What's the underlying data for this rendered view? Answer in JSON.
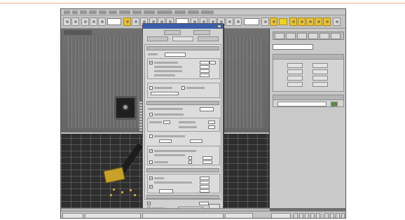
{
  "app": {
    "window_title": "",
    "menu_labels": [
      "",
      "",
      "",
      "",
      "",
      "",
      "",
      "",
      "",
      "",
      "",
      "",
      ""
    ]
  },
  "toolbar": {
    "selection_filter_value": "",
    "view_dropdown_value": "",
    "named_selection_value": ""
  },
  "viewport": {
    "label": ""
  },
  "command_panel": {
    "object_type_dropdown": "",
    "rollout_titles": [
      "",
      ""
    ],
    "button_labels": [
      "",
      "",
      "",
      "",
      "",
      "",
      "",
      "",
      "",
      ""
    ]
  },
  "render_dialog": {
    "title": "",
    "tabs": [
      "",
      "",
      "",
      "",
      ""
    ],
    "sections": [
      "",
      "",
      "",
      "",
      ""
    ],
    "footer": {
      "production_label": "",
      "activeshade_label": "",
      "preset_value": "",
      "viewport_value": "",
      "render_button": ""
    }
  },
  "status": {
    "selection_text": "",
    "prompt_text": "",
    "grid_text": ""
  },
  "colors": {
    "accent_yellow": "#e9c232",
    "dialog_title_blue": "#3b5ea8",
    "page_rule": "#f3b48a"
  }
}
